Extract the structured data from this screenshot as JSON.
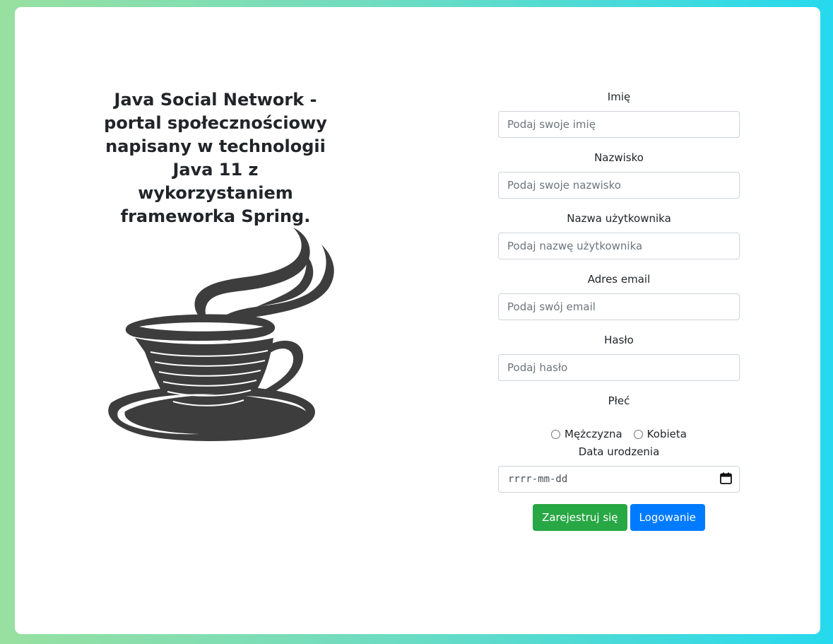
{
  "page": {
    "title": "Java Social Network - portal społecznościowy napisany w technologii Java 11 z wykorzystaniem frameworka Spring."
  },
  "form": {
    "first_name": {
      "label": "Imię",
      "placeholder": "Podaj swoje imię",
      "value": ""
    },
    "last_name": {
      "label": "Nazwisko",
      "placeholder": "Podaj swoje nazwisko",
      "value": ""
    },
    "username": {
      "label": "Nazwa użytkownika",
      "placeholder": "Podaj nazwę użytkownika",
      "value": ""
    },
    "email": {
      "label": "Adres email",
      "placeholder": "Podaj swój email",
      "value": ""
    },
    "password": {
      "label": "Hasło",
      "placeholder": "Podaj hasło",
      "value": ""
    },
    "gender": {
      "label": "Płeć",
      "options": [
        "Mężczyzna",
        "Kobieta"
      ],
      "selected": null
    },
    "birth_date": {
      "label": "Data urodzenia",
      "placeholder": "rrrr-mm-dd",
      "icon": "calendar-icon"
    }
  },
  "buttons": {
    "register": {
      "label": "Zarejestruj się",
      "color": "#28a745"
    },
    "login": {
      "label": "Logowanie",
      "color": "#007bff"
    }
  },
  "logo": {
    "icon": "coffee-cup-icon",
    "color": "#3d3d3d"
  },
  "colors": {
    "background_start": "#98e0a0",
    "background_end": "#26d9ee",
    "card": "#ffffff"
  }
}
